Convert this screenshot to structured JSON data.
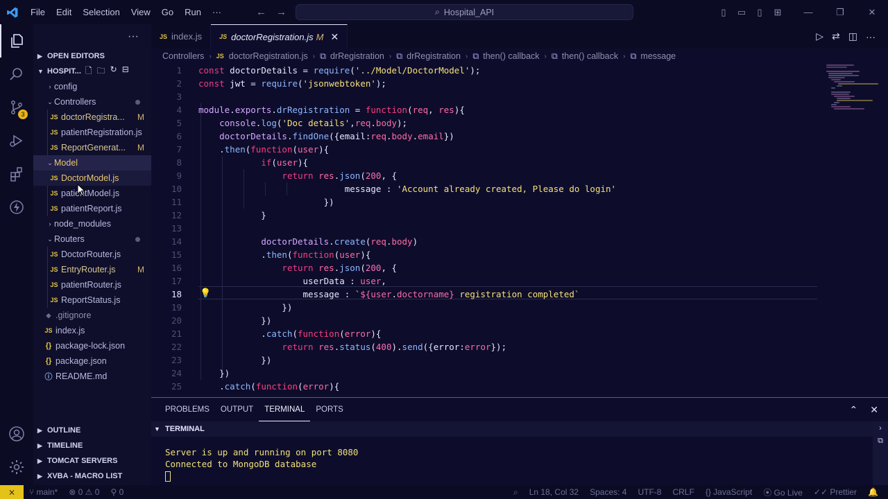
{
  "titlebar": {
    "menus": [
      "File",
      "Edit",
      "Selection",
      "View",
      "Go",
      "Run",
      "···"
    ],
    "search": "Hospital_API"
  },
  "activity": {
    "scm_badge": "3"
  },
  "explorer": {
    "open_editors": "OPEN EDITORS",
    "project": "HOSPIT...",
    "tree": [
      {
        "label": "config"
      },
      {
        "label": "Controllers"
      },
      {
        "label": "doctorRegistra...",
        "mod": "M"
      },
      {
        "label": "patientRegistration.js"
      },
      {
        "label": "ReportGenerat...",
        "mod": "M"
      },
      {
        "label": "Model"
      },
      {
        "label": "DoctorModel.js"
      },
      {
        "label": "patientModel.js"
      },
      {
        "label": "patientReport.js"
      },
      {
        "label": "node_modules"
      },
      {
        "label": "Routers"
      },
      {
        "label": "DoctorRouter.js"
      },
      {
        "label": "EntryRouter.js",
        "mod": "M"
      },
      {
        "label": "patientRouter.js"
      },
      {
        "label": "ReportStatus.js"
      },
      {
        "label": ".gitignore"
      },
      {
        "label": "index.js"
      },
      {
        "label": "package-lock.json"
      },
      {
        "label": "package.json"
      },
      {
        "label": "README.md"
      }
    ],
    "bottom_sections": [
      "OUTLINE",
      "TIMELINE",
      "TOMCAT SERVERS",
      "XVBA - MACRO LIST"
    ]
  },
  "tabs": [
    {
      "label": "index.js"
    },
    {
      "label": "doctorRegistration.js",
      "flag": "M"
    }
  ],
  "breadcrumb": [
    "Controllers",
    "doctorRegistration.js",
    "drRegistration",
    "drRegistration",
    "then() callback",
    "then() callback",
    "message"
  ],
  "editor": {
    "current_line": 18,
    "line_numbers": [
      "1",
      "2",
      "3",
      "4",
      "5",
      "6",
      "7",
      "8",
      "9",
      "10",
      "11",
      "12",
      "13",
      "14",
      "15",
      "16",
      "17",
      "18",
      "19",
      "20",
      "21",
      "22",
      "23",
      "24",
      "25"
    ]
  },
  "panel": {
    "tabs": [
      "PROBLEMS",
      "OUTPUT",
      "TERMINAL",
      "PORTS"
    ],
    "terminal_header": "TERMINAL",
    "lines": [
      "Server is up and running on port 8080",
      "Connected to MongoDB database"
    ]
  },
  "statusbar": {
    "branch": "main*",
    "errors": "0",
    "warnings": "0",
    "info": "0",
    "position": "Ln 18, Col 32",
    "spaces": "Spaces: 4",
    "encoding": "UTF-8",
    "eol": "CRLF",
    "language": "JavaScript",
    "golive": "Go Live",
    "prettier": "Prettier"
  },
  "colors": {
    "background": "#0d0d2b",
    "keyword": "#f43b86",
    "string": "#f6e07a",
    "accent_remote": "#e5c219"
  }
}
